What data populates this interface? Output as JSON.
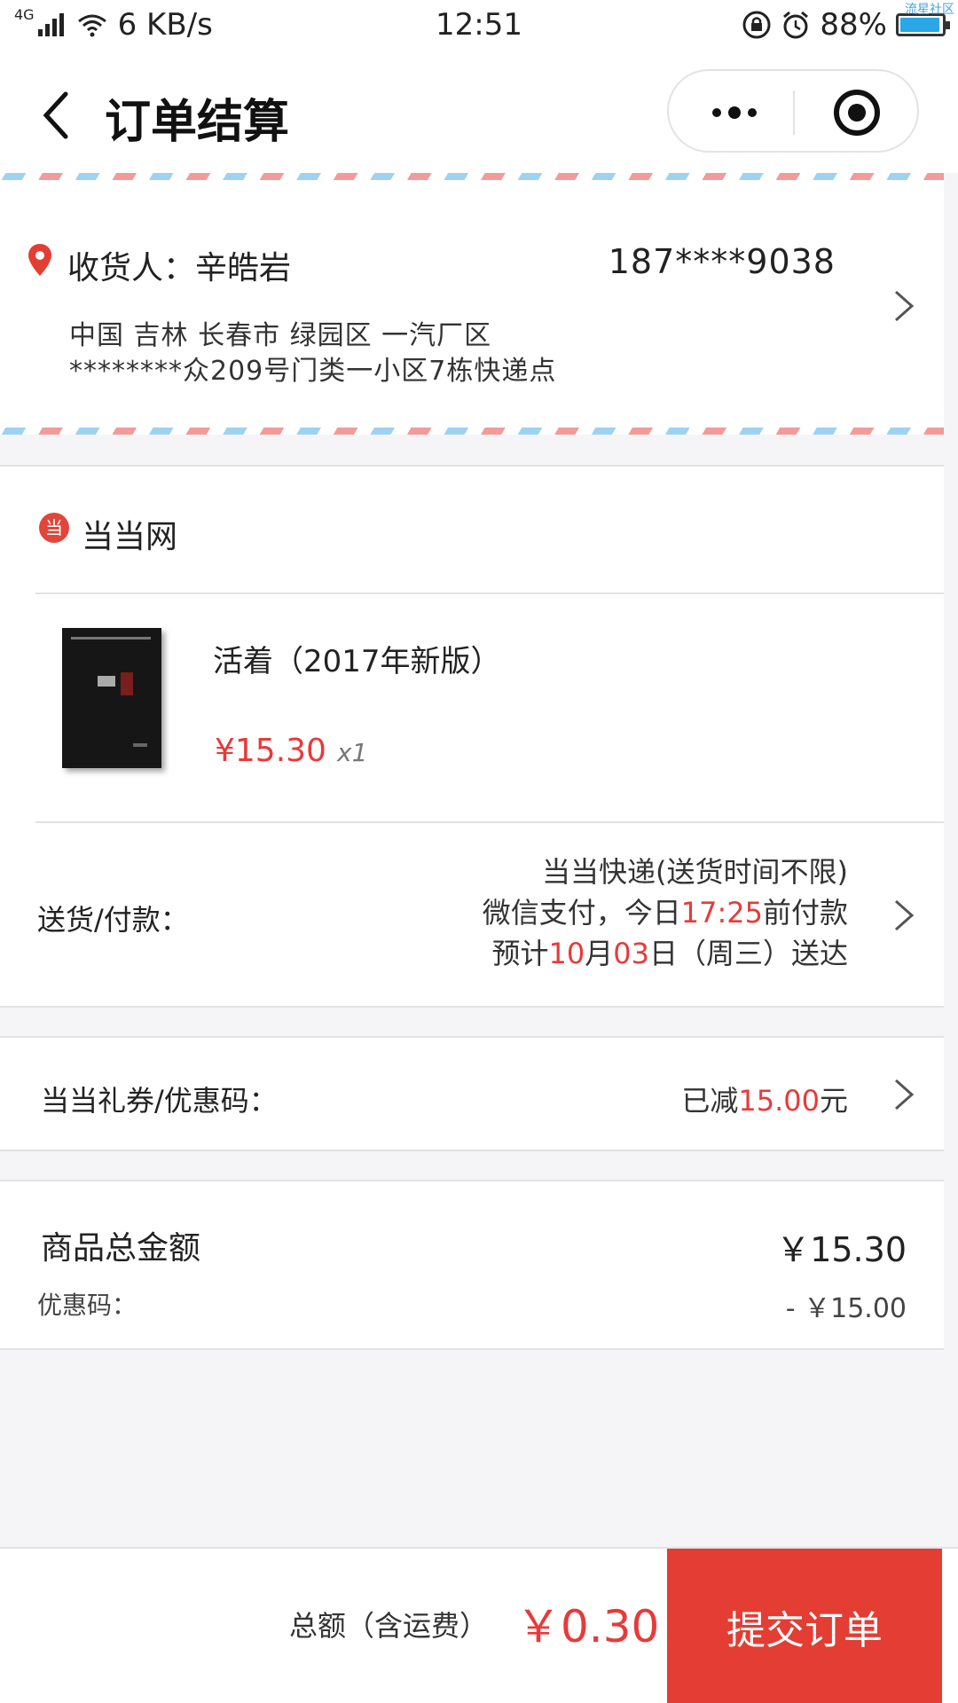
{
  "status_bar": {
    "network": "4G",
    "speed": "6 KB/s",
    "time": "12:51",
    "battery": "88%",
    "battery_level": 0.88,
    "watermark": "流星社区"
  },
  "nav": {
    "title": "订单结算"
  },
  "address": {
    "recipient": "收货人：辛皓岩",
    "phone": "187****9038",
    "line1": "中国  吉林  长春市  绿园区  一汽厂区",
    "line2": "********众209号门类一小区7栋快递点"
  },
  "shop": {
    "logo_char": "当",
    "name": "当当网"
  },
  "product": {
    "title": "活着（2017年新版）",
    "price": "¥15.30",
    "qty": "x1"
  },
  "delivery": {
    "label": "送货/付款：",
    "line1": "当当快递(送货时间不限)",
    "line2_prefix": "微信支付，今日",
    "line2_time": "17:25",
    "line2_suffix": "前付款",
    "line3_prefix": "预计",
    "line3_month": "10",
    "line3_mid": "月",
    "line3_day": "03",
    "line3_suffix": "日（周三）送达"
  },
  "coupon": {
    "label": "当当礼券/优惠码：",
    "prefix": "已减",
    "amount": "15.00",
    "suffix": "元"
  },
  "totals": {
    "goods_label": "商品总金额",
    "goods_value": "￥15.30",
    "discount_label": "优惠码：",
    "discount_value": "- ￥15.00"
  },
  "bottom": {
    "total_label": "总额（含运费）",
    "total_value": "￥0.30",
    "submit_label": "提交订单"
  },
  "colors": {
    "accent_red": "#e43d33",
    "price_red": "#e73a3a"
  }
}
